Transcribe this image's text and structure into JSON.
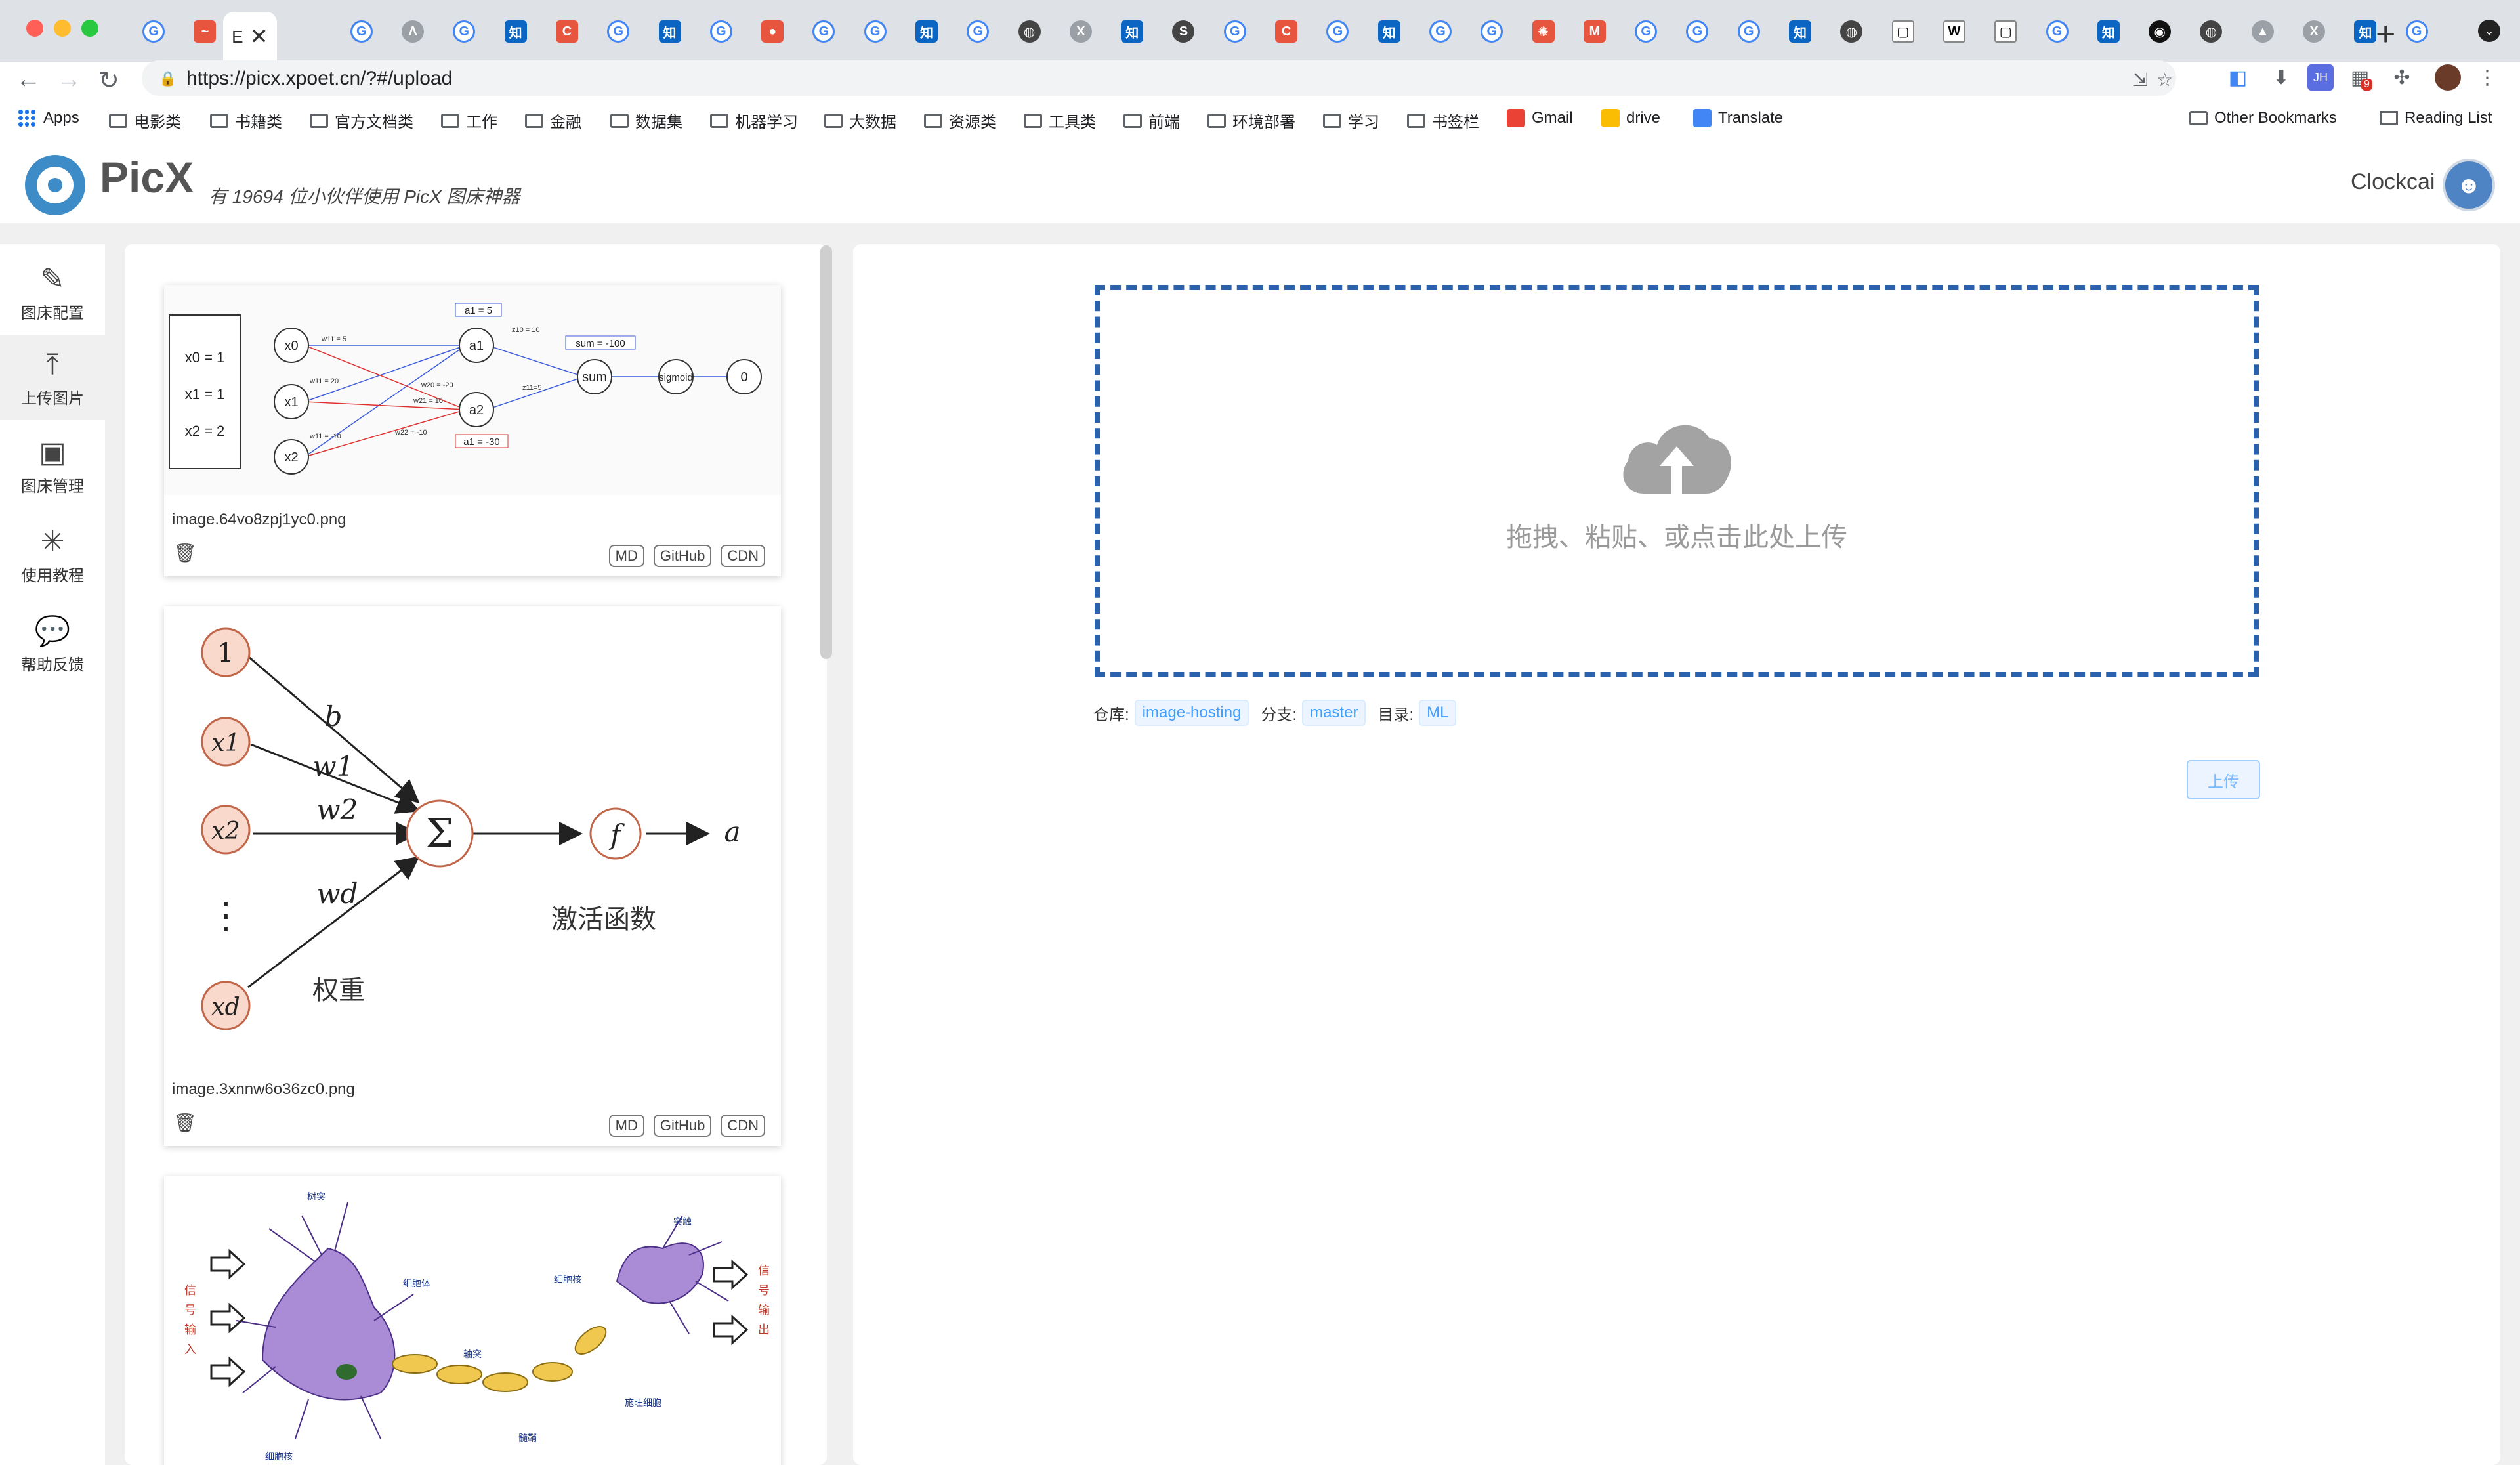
{
  "browser": {
    "url": "https://picx.xpoet.cn/?#/upload",
    "active_tab_label": "E",
    "bookmarks": [
      "Apps",
      "电影类",
      "书籍类",
      "官方文档类",
      "工作",
      "金融",
      "数据集",
      "机器学习",
      "大数据",
      "资源类",
      "工具类",
      "前端",
      "环境部署",
      "学习",
      "书签栏",
      "Gmail",
      "drive",
      "Translate",
      "Other Bookmarks",
      "Reading List"
    ],
    "extension_badge": "9",
    "extension_jh": "JH"
  },
  "header": {
    "app_name": "PicX",
    "slogan": "有 19694 位小伙伴使用 PicX 图床神器",
    "username": "Clockcai"
  },
  "sidebar": {
    "items": [
      {
        "label": "图床配置",
        "icon": "edit-icon"
      },
      {
        "label": "上传图片",
        "icon": "upload-icon"
      },
      {
        "label": "图床管理",
        "icon": "box-icon"
      },
      {
        "label": "使用教程",
        "icon": "loading-icon"
      },
      {
        "label": "帮助反馈",
        "icon": "chat-icon"
      }
    ]
  },
  "images": [
    {
      "name": "image.64vo8zpj1yc0.png",
      "buttons": [
        "MD",
        "GitHub",
        "CDN"
      ]
    },
    {
      "name": "image.3xnnw6o36zc0.png",
      "buttons": [
        "MD",
        "GitHub",
        "CDN"
      ]
    }
  ],
  "diagram1": {
    "inputs_box": [
      "x0 = 1",
      "x1 = 1",
      "x2 = 2"
    ],
    "nodes": [
      "x0",
      "x1",
      "x2",
      "a1",
      "a2",
      "sum",
      "sigmoid",
      "0"
    ],
    "labels": [
      "a1 = 5",
      "a1 = -30",
      "sum = -100",
      "w11 = 5",
      "w11 = 20",
      "w11 = -10",
      "w20 = -20",
      "w21 = 10",
      "w22 = -10",
      "z10 = 10",
      "z11=5"
    ]
  },
  "diagram2": {
    "inputs": [
      "1",
      "x1",
      "x2",
      "xd"
    ],
    "weights": [
      "b",
      "w1",
      "w2",
      "wd"
    ],
    "sum": "Σ",
    "func": "f",
    "output": "a",
    "caption_activation": "激活函数",
    "caption_weight": "权重",
    "dots": "⋮"
  },
  "diagram3": {
    "labels": [
      "树突",
      "细胞体",
      "轴突",
      "髓鞘",
      "细胞核",
      "突触",
      "细胞核",
      "施旺细胞"
    ],
    "left_caption": [
      "信",
      "号",
      "输",
      "入"
    ],
    "right_caption": [
      "信",
      "号",
      "输",
      "出"
    ]
  },
  "upload": {
    "dropzone_text": "拖拽、粘贴、或点击此处上传",
    "repo_label": "仓库:",
    "repo": "image-hosting",
    "branch_label": "分支:",
    "branch": "master",
    "dir_label": "目录:",
    "dir": "ML",
    "upload_button": "上传"
  }
}
